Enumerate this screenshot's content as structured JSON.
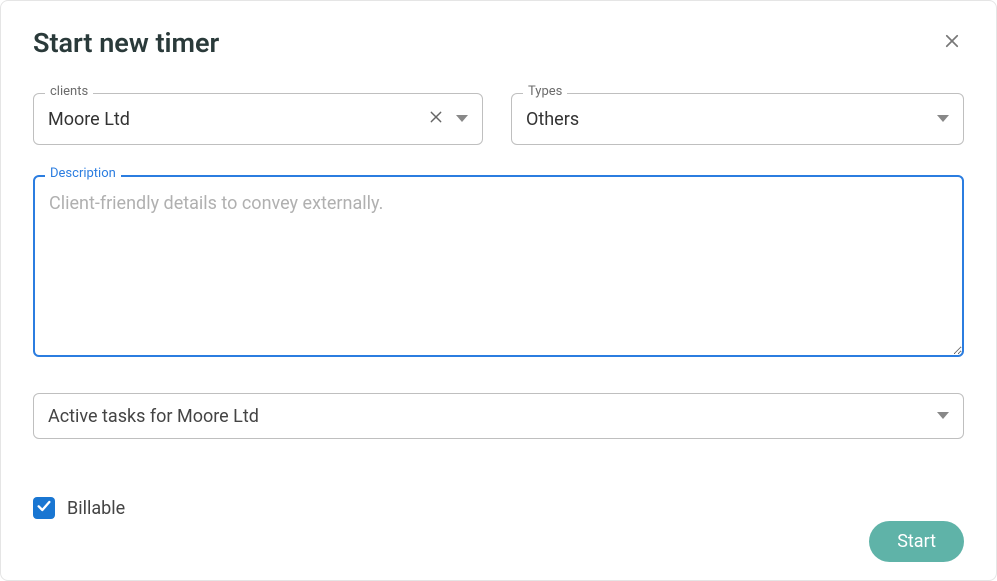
{
  "modal": {
    "title": "Start new timer",
    "clients": {
      "label": "clients",
      "value": "Moore Ltd"
    },
    "types": {
      "label": "Types",
      "value": "Others"
    },
    "description": {
      "label": "Description",
      "placeholder": "Client-friendly details to convey externally.",
      "value": ""
    },
    "tasks": {
      "value": "Active tasks for Moore Ltd"
    },
    "billable": {
      "label": "Billable",
      "checked": true
    },
    "start_label": "Start"
  }
}
